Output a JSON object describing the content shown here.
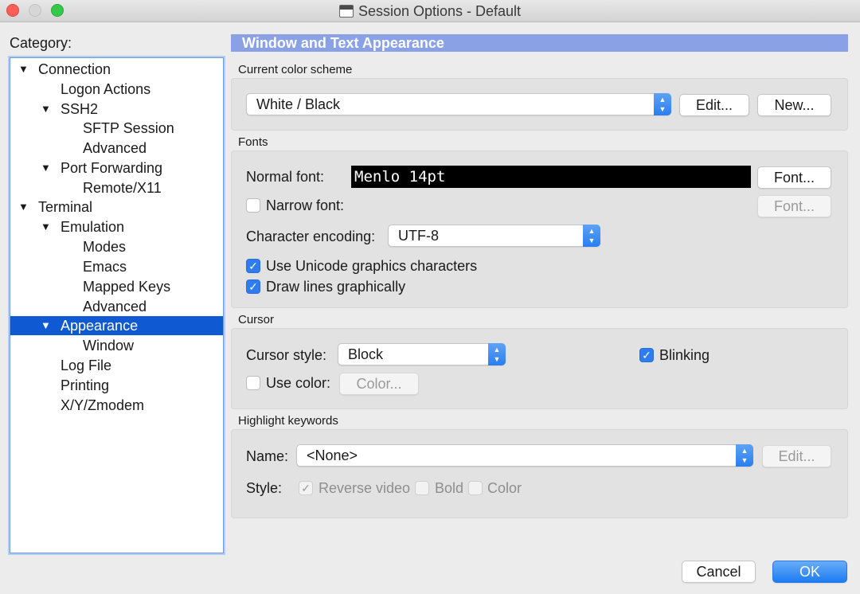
{
  "window": {
    "title": "Session Options - Default"
  },
  "category": {
    "label": "Category:",
    "items": [
      {
        "label": "Connection",
        "expanded": true
      },
      {
        "label": "Logon Actions"
      },
      {
        "label": "SSH2",
        "expanded": true
      },
      {
        "label": "SFTP Session"
      },
      {
        "label": "Advanced"
      },
      {
        "label": "Port Forwarding",
        "expanded": true
      },
      {
        "label": "Remote/X11"
      },
      {
        "label": "Terminal",
        "expanded": true
      },
      {
        "label": "Emulation",
        "expanded": true
      },
      {
        "label": "Modes"
      },
      {
        "label": "Emacs"
      },
      {
        "label": "Mapped Keys"
      },
      {
        "label": "Advanced"
      },
      {
        "label": "Appearance",
        "expanded": true,
        "selected": true
      },
      {
        "label": "Window"
      },
      {
        "label": "Log File"
      },
      {
        "label": "Printing"
      },
      {
        "label": "X/Y/Zmodem"
      }
    ]
  },
  "panel": {
    "title": "Window and Text Appearance"
  },
  "color_scheme": {
    "section_label": "Current color scheme",
    "value": "White / Black",
    "edit_label": "Edit...",
    "new_label": "New..."
  },
  "fonts": {
    "section_label": "Fonts",
    "normal_label": "Normal font:",
    "normal_value": "Menlo 14pt",
    "font_button": "Font...",
    "narrow_label": "Narrow font:",
    "narrow_checked": false,
    "narrow_button": "Font...",
    "encoding_label": "Character encoding:",
    "encoding_value": "UTF-8",
    "unicode_label": "Use Unicode graphics characters",
    "unicode_checked": true,
    "draw_lines_label": "Draw lines graphically",
    "draw_lines_checked": true
  },
  "cursor": {
    "section_label": "Cursor",
    "style_label": "Cursor style:",
    "style_value": "Block",
    "blinking_label": "Blinking",
    "blinking_checked": true,
    "use_color_label": "Use color:",
    "use_color_checked": false,
    "color_button": "Color..."
  },
  "highlight": {
    "section_label": "Highlight keywords",
    "name_label": "Name:",
    "name_value": "<None>",
    "edit_label": "Edit...",
    "style_label": "Style:",
    "reverse_label": "Reverse video",
    "reverse_checked": true,
    "bold_label": "Bold",
    "bold_checked": false,
    "color_label": "Color",
    "color_checked": false
  },
  "footer": {
    "cancel_label": "Cancel",
    "ok_label": "OK"
  },
  "colors": {
    "selection": "#0f5ad2",
    "header_bar": "#8ba1e6",
    "accent": "#2f7cf0"
  }
}
